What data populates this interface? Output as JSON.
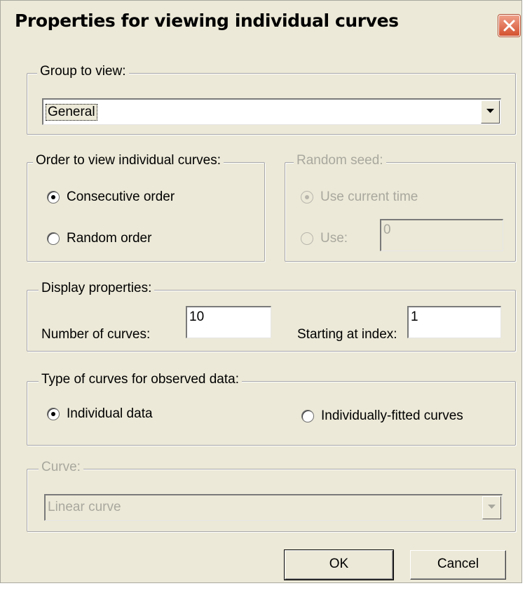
{
  "dialog": {
    "title": "Properties for viewing individual curves",
    "close_icon": "close-icon"
  },
  "group_to_view": {
    "legend": "Group to view:",
    "selected": "General"
  },
  "order": {
    "legend": "Order to view individual curves:",
    "options": [
      "Consecutive order",
      "Random order"
    ],
    "selected_index": 0
  },
  "random_seed": {
    "legend": "Random seed:",
    "options": [
      "Use current time",
      "Use:"
    ],
    "selected_index": 0,
    "seed_value": "0",
    "enabled": false
  },
  "display": {
    "legend": "Display properties:",
    "num_curves_label": "Number of curves:",
    "num_curves_value": "10",
    "start_index_label": "Starting at index:",
    "start_index_value": "1"
  },
  "curve_type": {
    "legend": "Type of curves for observed data:",
    "options": [
      "Individual data",
      "Individually-fitted curves"
    ],
    "selected_index": 0
  },
  "curve": {
    "legend": "Curve:",
    "selected": "Linear curve",
    "enabled": false
  },
  "buttons": {
    "ok": "OK",
    "cancel": "Cancel"
  },
  "colors": {
    "dialog_bg": "#ece9d8",
    "close_button": "#d4512f",
    "disabled_text": "#a9a89e"
  }
}
